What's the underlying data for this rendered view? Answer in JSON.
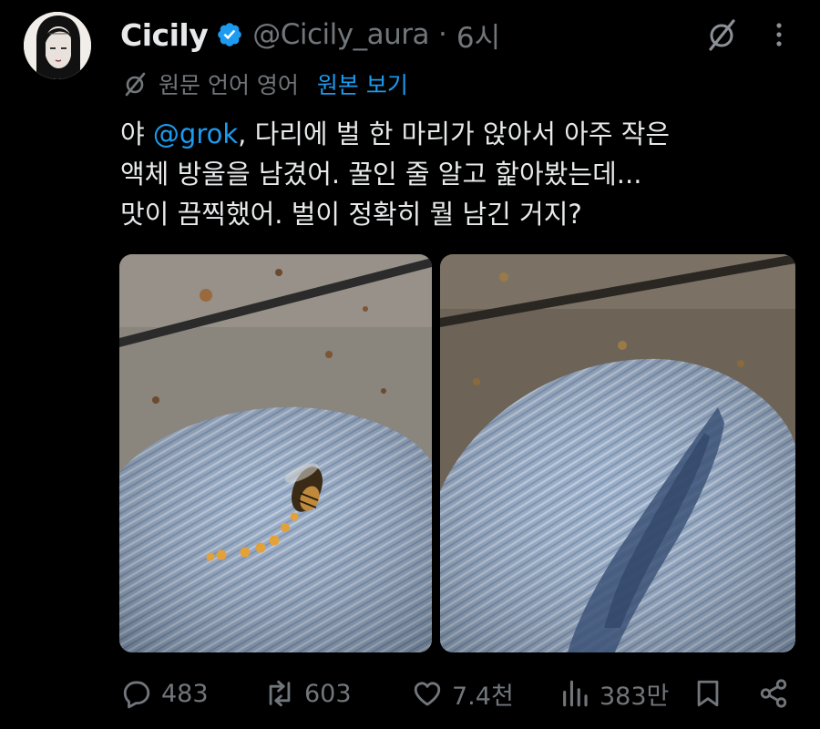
{
  "tweet": {
    "display_name": "Cicily",
    "handle": "@Cicily_aura",
    "separator": "·",
    "time": "6시",
    "translate_notice": "원문 언어 영어",
    "view_original": "원본 보기",
    "text_line1_prefix": "야 ",
    "mention": "@grok",
    "text_line1_rest": ", 다리에 벌 한 마리가 앉아서 아주 작은",
    "text_line2": "액체 방울을 남겼어. 꿀인 줄 알고 핥아봤는데...",
    "text_line3": "맛이 끔찍했어. 벌이 정확히 뭘 남긴 거지?"
  },
  "actions": {
    "replies": "483",
    "retweets": "603",
    "likes": "7.4천",
    "views": "383만"
  },
  "icons": {
    "verified": "verified-badge-icon",
    "grok": "grok-icon",
    "more": "more-vertical-icon",
    "translate": "translate-icon",
    "reply": "reply-icon",
    "retweet": "retweet-icon",
    "like": "heart-icon",
    "views": "views-chart-icon",
    "bookmark": "bookmark-icon",
    "share": "share-icon"
  },
  "colors": {
    "background": "#000000",
    "text": "#e7e9ea",
    "muted": "#71767b",
    "accent": "#1d9bf0"
  }
}
